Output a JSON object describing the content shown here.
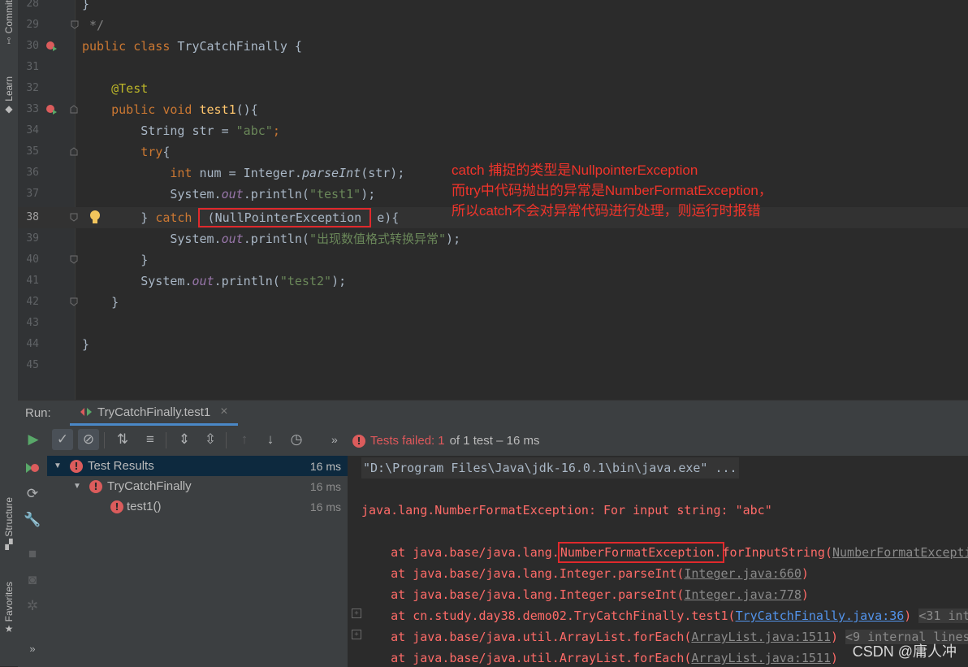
{
  "left_strip": {
    "top_tabs": [
      {
        "label": "Commit",
        "icon": "commit-icon"
      },
      {
        "label": "Learn",
        "icon": "learn-icon"
      }
    ],
    "bottom_tabs": [
      {
        "label": "Structure",
        "icon": "structure-icon"
      },
      {
        "label": "Favorites",
        "icon": "star-icon"
      }
    ],
    "more": "»"
  },
  "editor": {
    "current_line": "38",
    "lines": [
      {
        "num": "28",
        "text": "}"
      },
      {
        "num": "29",
        "text": "*/"
      },
      {
        "num": "30",
        "kw": "public class",
        "name": "TryCatchFinally",
        "rest": "{"
      },
      {
        "num": "31"
      },
      {
        "num": "32",
        "annotation": "@Test"
      },
      {
        "num": "33",
        "kw1": "public",
        "kw2": "void",
        "method": "test1",
        "rest": "(){"
      },
      {
        "num": "34",
        "type": "String str = ",
        "value": "\"abc\"",
        "end": ";"
      },
      {
        "num": "35",
        "kw": "try",
        "rest": "{"
      },
      {
        "num": "36",
        "kw": "int",
        "mid": " num = Integer.",
        "call": "parseInt",
        "end": "(str);"
      },
      {
        "num": "37",
        "pre": "System.",
        "field": "out",
        "mid": ".println(",
        "value": "\"test1\"",
        "end": ");"
      },
      {
        "num": "38",
        "pre": "} ",
        "kw": "catch",
        "mid": " (",
        "boxed": "NullPointerException",
        "end": " e){"
      },
      {
        "num": "39",
        "pre": "System.",
        "field": "out",
        "mid": ".println(",
        "value": "\"出现数值格式转换异常\"",
        "end": ");"
      },
      {
        "num": "40",
        "text": "}"
      },
      {
        "num": "41",
        "pre": "System.",
        "field": "out",
        "mid": ".println(",
        "value": "\"test2\"",
        "end": ");"
      },
      {
        "num": "42",
        "text": "}"
      },
      {
        "num": "43"
      },
      {
        "num": "44",
        "text": "}"
      },
      {
        "num": "45"
      }
    ],
    "annotation_lines": [
      "catch 捕捉的类型是NullpointerException",
      "而try中代码抛出的异常是NumberFormatException，",
      "所以catch不会对异常代码进行处理，则运行时报错"
    ]
  },
  "run_panel": {
    "label": "Run:",
    "tab_title": "TryCatchFinally.test1",
    "tab_close": "×",
    "status": {
      "failed_label": "Tests failed:",
      "failed_count": "1",
      "rest": "of 1 test – 16 ms",
      "more": "»"
    },
    "tree": [
      {
        "label": "Test Results",
        "time": "16 ms"
      },
      {
        "label": "TryCatchFinally",
        "time": "16 ms"
      },
      {
        "label": "test1()",
        "time": "16 ms"
      }
    ],
    "console": {
      "cmd": "\"D:\\Program Files\\Java\\jdk-16.0.1\\bin\\java.exe\" ...",
      "exception": "java.lang.NumberFormatException: For input string: \"abc\"",
      "frames": [
        {
          "pre": "at java.base/java.lang.",
          "boxed": "NumberFormatException.",
          "method": "forInputString(",
          "link": "NumberFormatExcepti"
        },
        {
          "pre": "at java.base/java.lang.Integer.parseInt(",
          "link": "Integer.java:660",
          "post": ")"
        },
        {
          "pre": "at java.base/java.lang.Integer.parseInt(",
          "link": "Integer.java:778",
          "post": ")"
        },
        {
          "pre": "at cn.study.day38.demo02.TryCatchFinally.test1(",
          "link": "TryCatchFinally.java:36",
          "post": ")",
          "tag": "<31 int"
        },
        {
          "pre": "at java.base/java.util.ArrayList.forEach(",
          "link": "ArrayList.java:1511",
          "post": ")",
          "tag": "<9 internal lines"
        },
        {
          "pre": "at java.base/java.util.ArrayList.forEach(",
          "link": "ArrayList.java:1511",
          "post": ")"
        }
      ]
    }
  },
  "watermark": "CSDN @庸人冲",
  "colors": {
    "accent_red": "#e0292c",
    "error_text": "#ff6b68",
    "link_blue": "#5394ec",
    "tab_underline": "#4a88c7"
  }
}
